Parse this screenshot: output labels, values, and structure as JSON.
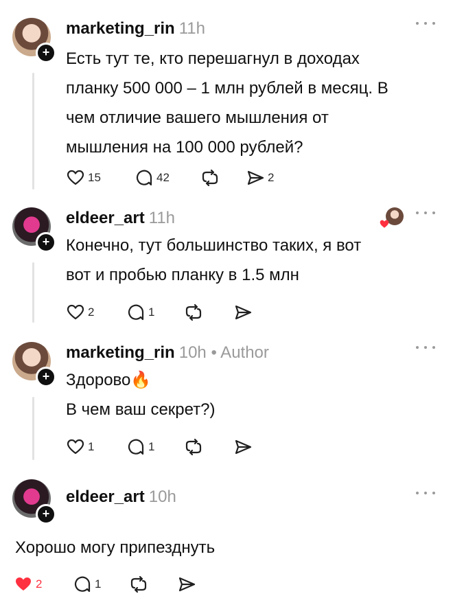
{
  "posts": [
    {
      "username": "marketing_rin",
      "time": "11h",
      "author_tag": "",
      "text_lines": [
        "Есть тут те, кто перешагнул в доходах",
        "планку 500 000 – 1 млн рублей в месяц. В",
        "чем отличие вашего мышления от",
        "мышления на 100 000 рублей?"
      ],
      "likes": "15",
      "comments": "42",
      "shares": "2"
    },
    {
      "username": "eldeer_art",
      "time": "11h",
      "author_tag": "",
      "text_lines": [
        "Конечно, тут большинство таких, я вот",
        "вот и пробью планку в 1.5 млн"
      ],
      "likes": "2",
      "comments": "1",
      "shares": ""
    },
    {
      "username": "marketing_rin",
      "time": "10h",
      "author_tag": "• Author",
      "text_lines": [
        "Здорово🔥",
        "В чем ваш секрет?)"
      ],
      "likes": "1",
      "comments": "1",
      "shares": ""
    },
    {
      "username": "eldeer_art",
      "time": "10h",
      "author_tag": "",
      "text_lines": [
        "Хорошо могу припезднуть"
      ],
      "likes": "2",
      "comments": "1",
      "shares": ""
    }
  ],
  "colors": {
    "like_active": "#ff3040",
    "muted": "#9a9a9a",
    "text": "#101010"
  },
  "icons": [
    "heart-icon",
    "comment-icon",
    "repost-icon",
    "share-icon",
    "more-icon",
    "plus-icon"
  ]
}
